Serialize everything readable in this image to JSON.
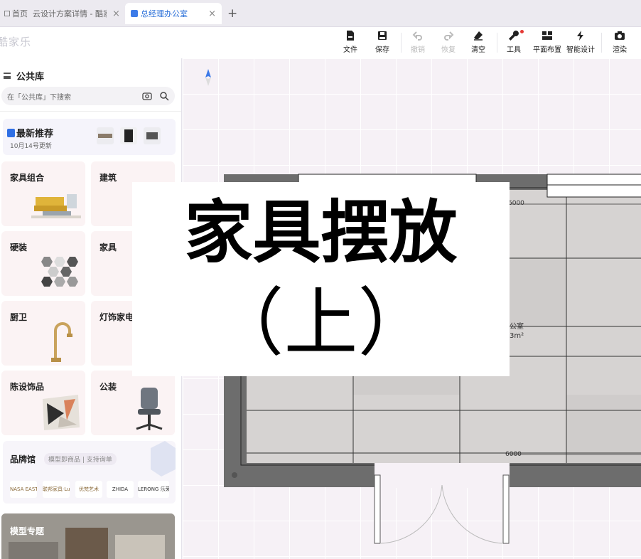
{
  "tabs": [
    {
      "label": "首页",
      "active": false
    },
    {
      "label": "云设计方案详情 - 酷家",
      "active": false
    },
    {
      "label": "总经理办公室",
      "active": true
    }
  ],
  "brand": "酷家乐",
  "toolbar": {
    "file": "文件",
    "save": "保存",
    "undo": "撤销",
    "redo": "恢复",
    "clear": "清空",
    "tools": "工具",
    "floor_layout": "平面布置",
    "smart_design": "智能设计",
    "render": "渲染"
  },
  "sidebar": {
    "title": "公共库",
    "search_placeholder": "在「公共库」下搜索",
    "recommend": {
      "title": "最新推荐",
      "subtitle": "10月14号更新"
    },
    "categories": [
      "家具组合",
      "建筑",
      "硬装",
      "家具",
      "厨卫",
      "灯饰家电",
      "陈设饰品",
      "公装"
    ],
    "brand_hall": {
      "title": "品牌馆",
      "tag": "模型即商品 | 支持询单",
      "logos": [
        "NASA EASTY",
        "联邦家具·Lux",
        "优梵艺术",
        "ZHIDA",
        "LERONG 乐荣"
      ]
    },
    "models": {
      "title": "模型专题"
    }
  },
  "canvas": {
    "room_name": "公室",
    "room_area": "3m²",
    "dim_top": "6000",
    "dim_bottom": "6000"
  },
  "overlay": {
    "line1": "家具摆放",
    "line2": "（上）"
  }
}
